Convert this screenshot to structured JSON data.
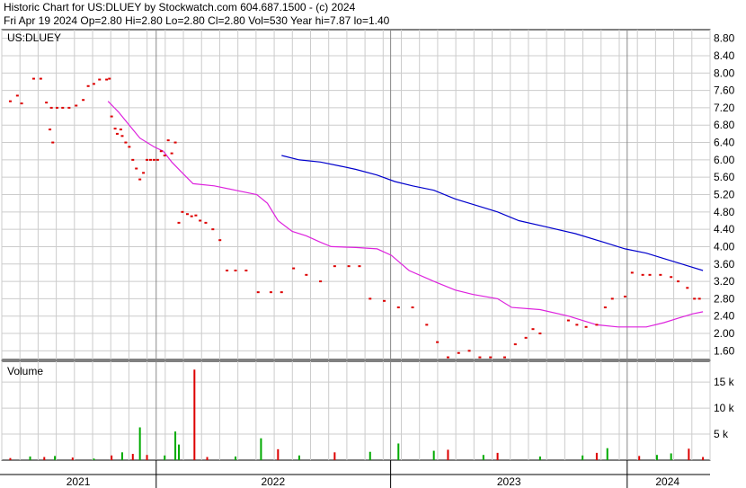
{
  "header": {
    "line1": "Historic Chart for US:DLUEY by Stockwatch.com 604.687.1500 - (c) 2024",
    "line2": "Fri Apr 19 2024  Op=2.80  Hi=2.80  Lo=2.80  Cl=2.80  Vol=530  Year hi=7.87  lo=1.40"
  },
  "chart_data": [
    {
      "type": "scatter",
      "title": "US:DLUEY",
      "ylim": [
        1.4,
        9.0
      ],
      "y_ticks": [
        "8.80",
        "8.40",
        "8.00",
        "7.60",
        "7.20",
        "6.80",
        "6.40",
        "6.00",
        "5.60",
        "5.20",
        "4.80",
        "4.40",
        "4.00",
        "3.60",
        "3.20",
        "2.80",
        "2.40",
        "2.00",
        "1.60"
      ],
      "x_labels": [
        "2021",
        "2022",
        "2023",
        "2024"
      ],
      "grid": true,
      "colors": {
        "price": "#dd0000",
        "ma_short": "#dd22dd",
        "ma_long": "#0000cc",
        "up_vol": "#00aa00",
        "down_vol": "#dd0000",
        "grid": "#cccccc"
      },
      "price_points": [
        [
          0.012,
          7.35
        ],
        [
          0.022,
          7.48
        ],
        [
          0.028,
          7.3
        ],
        [
          0.045,
          7.87
        ],
        [
          0.055,
          7.87
        ],
        [
          0.063,
          7.32
        ],
        [
          0.07,
          7.2
        ],
        [
          0.078,
          7.2
        ],
        [
          0.086,
          7.2
        ],
        [
          0.095,
          7.2
        ],
        [
          0.105,
          7.25
        ],
        [
          0.115,
          7.38
        ],
        [
          0.122,
          7.7
        ],
        [
          0.13,
          7.75
        ],
        [
          0.138,
          7.85
        ],
        [
          0.148,
          7.85
        ],
        [
          0.152,
          7.87
        ],
        [
          0.068,
          6.7
        ],
        [
          0.072,
          6.4
        ],
        [
          0.155,
          7.0
        ],
        [
          0.16,
          6.72
        ],
        [
          0.163,
          6.6
        ],
        [
          0.168,
          6.7
        ],
        [
          0.17,
          6.55
        ],
        [
          0.175,
          6.4
        ],
        [
          0.18,
          6.3
        ],
        [
          0.185,
          6.0
        ],
        [
          0.19,
          5.8
        ],
        [
          0.195,
          5.55
        ],
        [
          0.2,
          5.7
        ],
        [
          0.205,
          6.0
        ],
        [
          0.21,
          6.0
        ],
        [
          0.215,
          6.0
        ],
        [
          0.22,
          6.0
        ],
        [
          0.225,
          6.2
        ],
        [
          0.23,
          6.1
        ],
        [
          0.235,
          6.45
        ],
        [
          0.24,
          6.15
        ],
        [
          0.245,
          6.4
        ],
        [
          0.25,
          4.55
        ],
        [
          0.255,
          4.8
        ],
        [
          0.262,
          4.75
        ],
        [
          0.268,
          4.7
        ],
        [
          0.274,
          4.72
        ],
        [
          0.28,
          4.6
        ],
        [
          0.288,
          4.55
        ],
        [
          0.298,
          4.4
        ],
        [
          0.308,
          4.15
        ],
        [
          0.318,
          3.45
        ],
        [
          0.33,
          3.45
        ],
        [
          0.345,
          3.45
        ],
        [
          0.362,
          2.95
        ],
        [
          0.38,
          2.95
        ],
        [
          0.395,
          2.95
        ],
        [
          0.412,
          3.5
        ],
        [
          0.43,
          3.35
        ],
        [
          0.45,
          3.2
        ],
        [
          0.47,
          3.55
        ],
        [
          0.49,
          3.55
        ],
        [
          0.505,
          3.55
        ],
        [
          0.52,
          2.8
        ],
        [
          0.54,
          2.75
        ],
        [
          0.56,
          2.6
        ],
        [
          0.58,
          2.6
        ],
        [
          0.6,
          2.2
        ],
        [
          0.615,
          1.8
        ],
        [
          0.63,
          1.45
        ],
        [
          0.645,
          1.55
        ],
        [
          0.66,
          1.6
        ],
        [
          0.675,
          1.45
        ],
        [
          0.69,
          1.45
        ],
        [
          0.71,
          1.45
        ],
        [
          0.725,
          1.75
        ],
        [
          0.74,
          1.9
        ],
        [
          0.75,
          2.1
        ],
        [
          0.76,
          2.0
        ],
        [
          0.8,
          2.3
        ],
        [
          0.812,
          2.2
        ],
        [
          0.825,
          2.15
        ],
        [
          0.84,
          2.2
        ],
        [
          0.852,
          2.6
        ],
        [
          0.862,
          2.8
        ],
        [
          0.88,
          2.85
        ],
        [
          0.89,
          3.4
        ],
        [
          0.905,
          3.35
        ],
        [
          0.915,
          3.35
        ],
        [
          0.93,
          3.35
        ],
        [
          0.945,
          3.3
        ],
        [
          0.955,
          3.2
        ],
        [
          0.968,
          3.05
        ],
        [
          0.978,
          2.8
        ],
        [
          0.985,
          2.8
        ]
      ],
      "ma_short": [
        [
          0.15,
          7.35
        ],
        [
          0.165,
          7.1
        ],
        [
          0.18,
          6.8
        ],
        [
          0.195,
          6.5
        ],
        [
          0.215,
          6.3
        ],
        [
          0.228,
          6.2
        ],
        [
          0.24,
          5.95
        ],
        [
          0.255,
          5.7
        ],
        [
          0.27,
          5.45
        ],
        [
          0.3,
          5.4
        ],
        [
          0.33,
          5.3
        ],
        [
          0.36,
          5.2
        ],
        [
          0.375,
          5.0
        ],
        [
          0.39,
          4.6
        ],
        [
          0.41,
          4.35
        ],
        [
          0.43,
          4.25
        ],
        [
          0.45,
          4.1
        ],
        [
          0.465,
          4.0
        ],
        [
          0.5,
          3.98
        ],
        [
          0.53,
          3.95
        ],
        [
          0.55,
          3.8
        ],
        [
          0.575,
          3.45
        ],
        [
          0.61,
          3.2
        ],
        [
          0.64,
          3.0
        ],
        [
          0.665,
          2.9
        ],
        [
          0.7,
          2.8
        ],
        [
          0.72,
          2.6
        ],
        [
          0.76,
          2.55
        ],
        [
          0.8,
          2.4
        ],
        [
          0.84,
          2.2
        ],
        [
          0.87,
          2.15
        ],
        [
          0.91,
          2.15
        ],
        [
          0.935,
          2.25
        ],
        [
          0.955,
          2.35
        ],
        [
          0.975,
          2.45
        ],
        [
          0.99,
          2.5
        ]
      ],
      "ma_long": [
        [
          0.395,
          6.1
        ],
        [
          0.42,
          6.0
        ],
        [
          0.45,
          5.95
        ],
        [
          0.48,
          5.85
        ],
        [
          0.5,
          5.78
        ],
        [
          0.53,
          5.65
        ],
        [
          0.555,
          5.5
        ],
        [
          0.58,
          5.4
        ],
        [
          0.61,
          5.3
        ],
        [
          0.64,
          5.1
        ],
        [
          0.67,
          4.95
        ],
        [
          0.7,
          4.8
        ],
        [
          0.73,
          4.6
        ],
        [
          0.77,
          4.45
        ],
        [
          0.81,
          4.3
        ],
        [
          0.85,
          4.1
        ],
        [
          0.88,
          3.95
        ],
        [
          0.91,
          3.85
        ],
        [
          0.94,
          3.7
        ],
        [
          0.97,
          3.55
        ],
        [
          0.99,
          3.45
        ]
      ]
    },
    {
      "type": "bar",
      "title": "Volume",
      "ylim": [
        0,
        19000
      ],
      "y_ticks": [
        "15 k",
        "10 k",
        "5 k"
      ],
      "bars": [
        [
          0.012,
          400,
          "d"
        ],
        [
          0.04,
          700,
          "u"
        ],
        [
          0.06,
          600,
          "d"
        ],
        [
          0.075,
          800,
          "u"
        ],
        [
          0.1,
          500,
          "d"
        ],
        [
          0.13,
          300,
          "u"
        ],
        [
          0.155,
          900,
          "d"
        ],
        [
          0.17,
          1500,
          "u"
        ],
        [
          0.185,
          1200,
          "d"
        ],
        [
          0.195,
          6300,
          "u"
        ],
        [
          0.205,
          1000,
          "d"
        ],
        [
          0.23,
          900,
          "u"
        ],
        [
          0.245,
          5500,
          "u"
        ],
        [
          0.25,
          3000,
          "u"
        ],
        [
          0.272,
          17400,
          "d"
        ],
        [
          0.29,
          600,
          "d"
        ],
        [
          0.33,
          700,
          "u"
        ],
        [
          0.366,
          4200,
          "u"
        ],
        [
          0.39,
          2100,
          "d"
        ],
        [
          0.42,
          900,
          "u"
        ],
        [
          0.47,
          1500,
          "d"
        ],
        [
          0.52,
          1600,
          "u"
        ],
        [
          0.56,
          3200,
          "u"
        ],
        [
          0.61,
          1800,
          "u"
        ],
        [
          0.63,
          2000,
          "d"
        ],
        [
          0.68,
          1000,
          "u"
        ],
        [
          0.7,
          1400,
          "d"
        ],
        [
          0.76,
          700,
          "u"
        ],
        [
          0.82,
          900,
          "u"
        ],
        [
          0.84,
          1400,
          "d"
        ],
        [
          0.855,
          2300,
          "u"
        ],
        [
          0.9,
          800,
          "d"
        ],
        [
          0.925,
          1000,
          "u"
        ],
        [
          0.945,
          1300,
          "u"
        ],
        [
          0.97,
          2200,
          "d"
        ],
        [
          0.99,
          600,
          "d"
        ]
      ]
    }
  ]
}
